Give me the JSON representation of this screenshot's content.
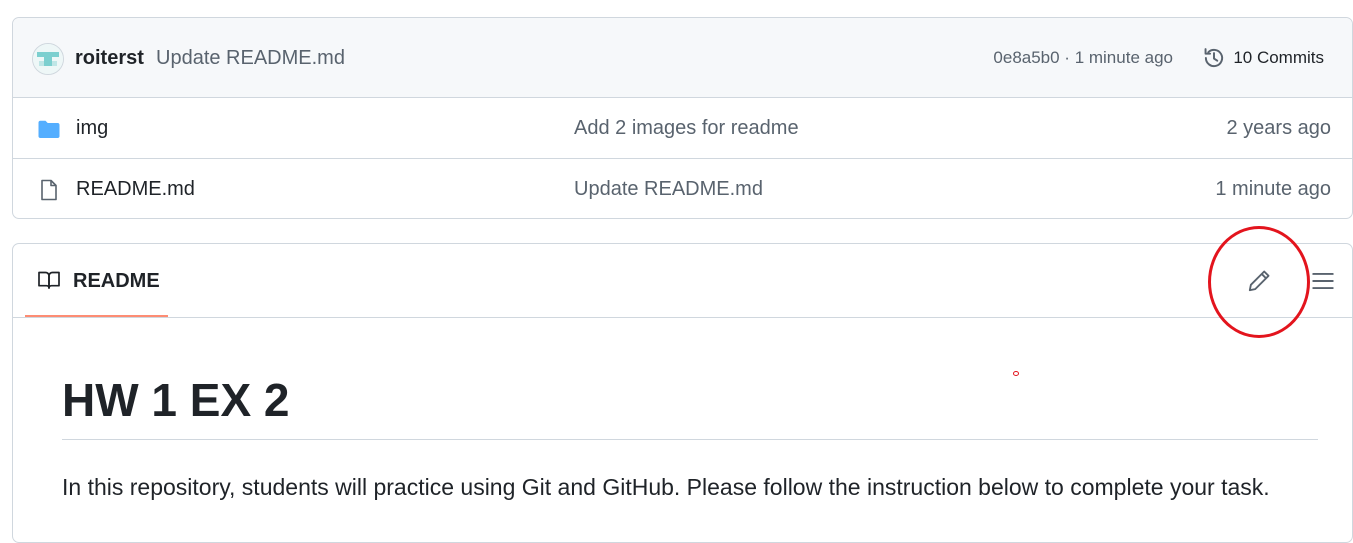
{
  "commit": {
    "author": "roiterst",
    "message": "Update README.md",
    "meta": "0e8a5b0 · 1 minute ago",
    "commits_label": "10 Commits"
  },
  "files": [
    {
      "name": "img",
      "type": "folder",
      "icon": "folder-icon",
      "message": "Add 2 images for readme",
      "age": "2 years ago"
    },
    {
      "name": "README.md",
      "type": "file",
      "icon": "file-icon",
      "message": "Update README.md",
      "age": "1 minute ago"
    }
  ],
  "readme": {
    "tab_label": "README",
    "heading": "HW 1 EX 2",
    "paragraph": "In this repository, students will practice using Git and GitHub. Please follow the instruction below to complete your task."
  },
  "colors": {
    "folder": "#54aeff",
    "tab_underline": "#fd8c73",
    "annotation": "#e3141d"
  }
}
